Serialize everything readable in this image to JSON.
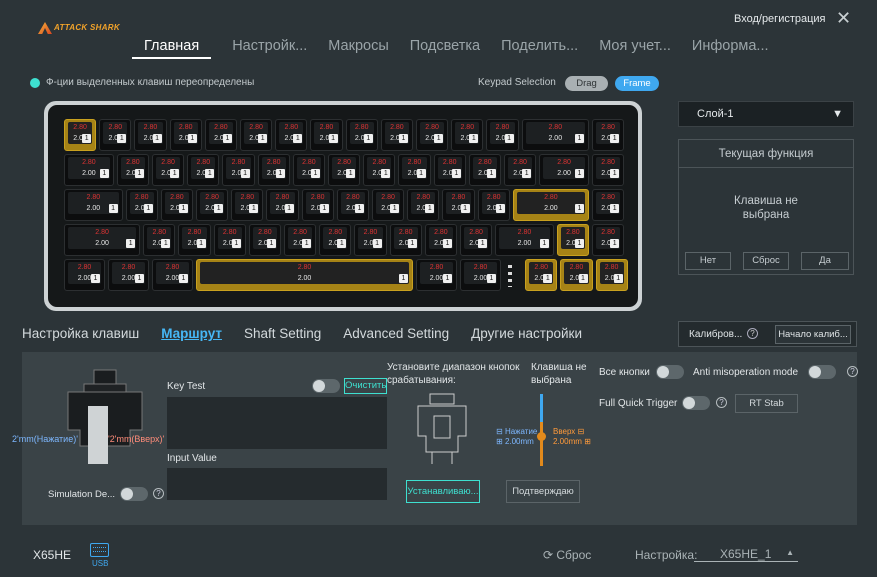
{
  "header": {
    "logo_text": "ATTACK SHARK",
    "login": "Вход/регистрация",
    "close": "✕",
    "nav": [
      "Главная",
      "Настройк...",
      "Макросы",
      "Подсветка",
      "Поделить...",
      "Моя учет...",
      "Информа..."
    ]
  },
  "notice": "Ф-ции выделенных клавиш переопределены",
  "keypad": {
    "label": "Keypad Selection",
    "drag": "Drag",
    "frame": "Frame"
  },
  "key_values": {
    "press": "2.80",
    "release": "2.00",
    "badge": "1"
  },
  "layer_select": {
    "value": "Слой-1",
    "arrow": "▼"
  },
  "current_function": {
    "title": "Текущая функция",
    "message_line1": "Клавиша не",
    "message_line2": "выбрана",
    "buttons": [
      "Нет",
      "Сброс",
      "Да"
    ]
  },
  "subtabs": [
    "Настройка клавиш",
    "Маршрут",
    "Shaft Setting",
    "Advanced Setting",
    "Другие настройки"
  ],
  "calibration": {
    "label": "Калибров...",
    "help": "?",
    "button": "Начало калиб..."
  },
  "route": {
    "press_label": "2'mm(Нажатие)'",
    "release_label": "'2'mm(Вверх)'",
    "simulation": "Simulation De...",
    "help": "?",
    "key_test": "Key Test",
    "clear": "Очистить",
    "input_value": "Input Value",
    "range_title_1": "Установите диапазон кнопок",
    "range_title_2": "срабатывания:",
    "key_not_selected_1": "Клавиша не",
    "key_not_selected_2": "выбрана",
    "press_small": "Нажатие",
    "press_val": "2.00mm",
    "up_small": "Вверх",
    "up_val": "2.00mm",
    "set_btn": "Устанавливаю...",
    "confirm_btn": "Подтверждаю",
    "all_keys": "Все кнопки",
    "anti_mis": "Anti misoperation mode",
    "fqt": "Full Quick Trigger",
    "rt_stab": "RT Stab"
  },
  "footer": {
    "device": "X65HE",
    "usb": "USB",
    "reset": "Сброс",
    "config_label": "Настройка:",
    "config_value": "X65HE_1"
  },
  "colors": {
    "accent": "#46b7f5",
    "cyan": "#3ee0d0",
    "gold": "#c9a11f"
  }
}
